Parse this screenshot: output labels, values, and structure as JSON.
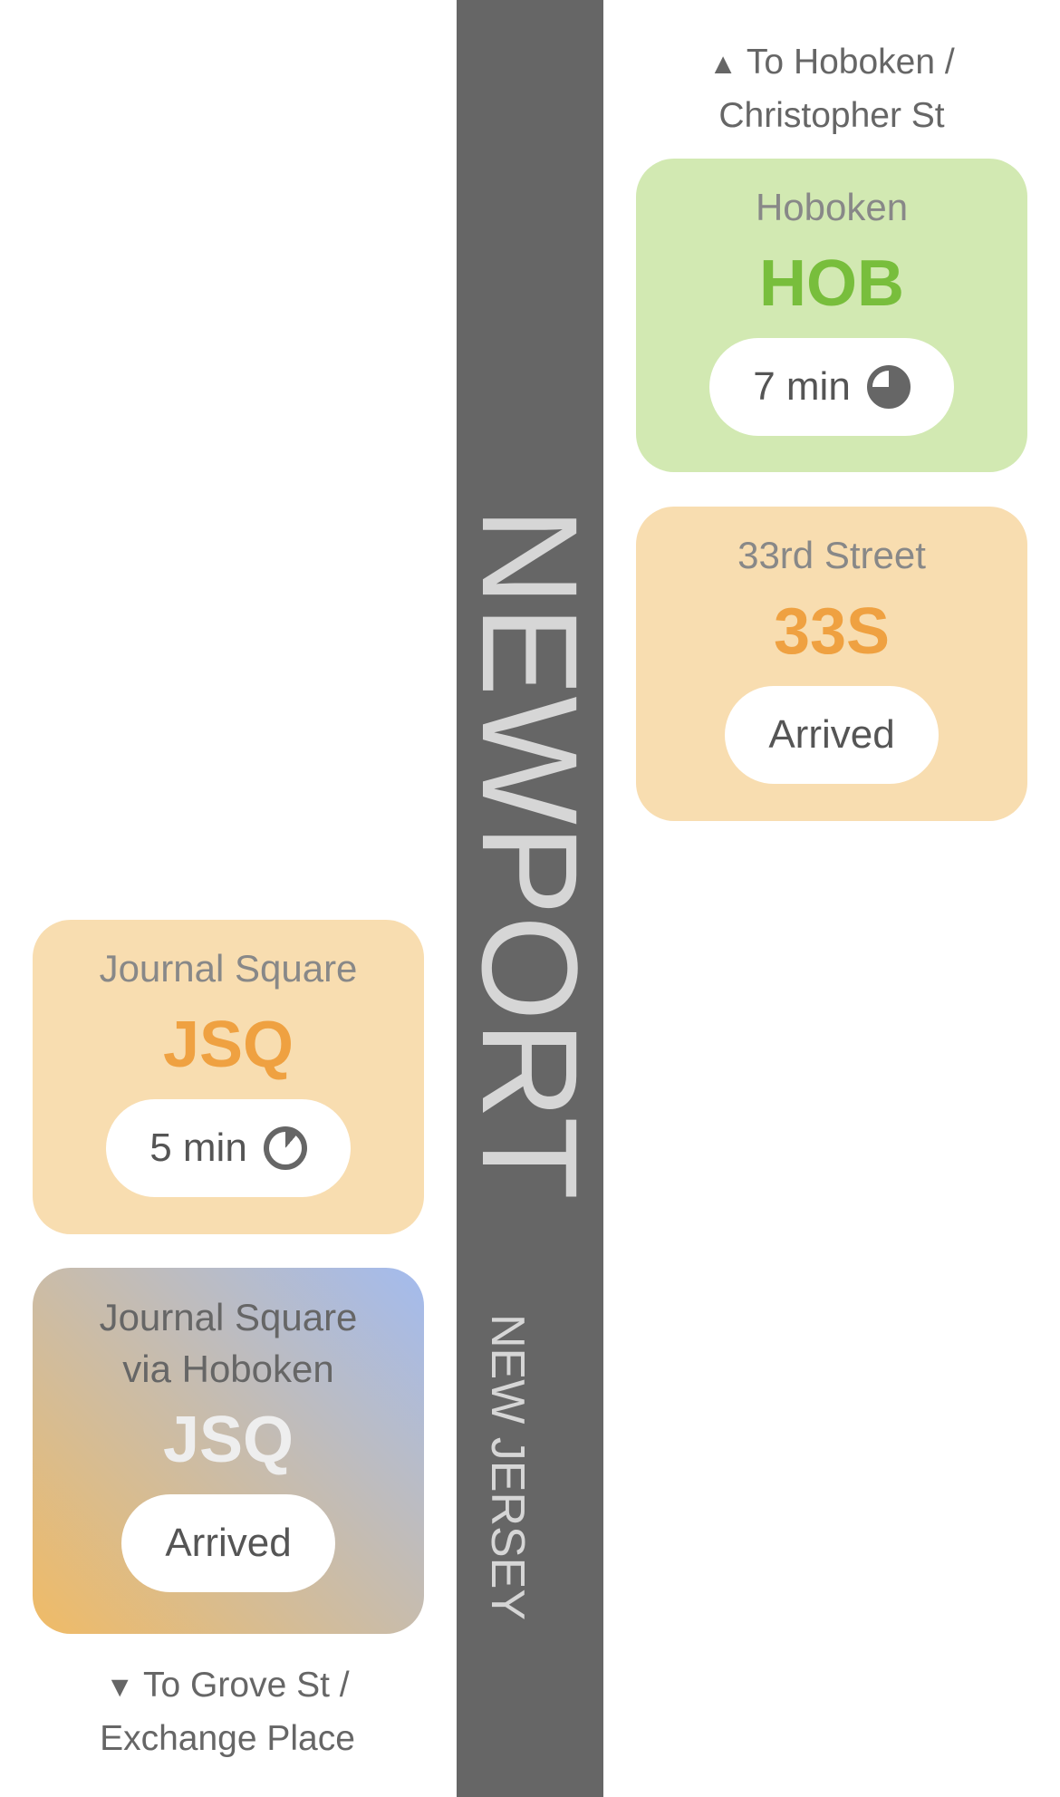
{
  "station": {
    "name": "NEWPORT",
    "state": "NEW JERSEY"
  },
  "directions": {
    "north": {
      "arrow": "▲",
      "line1": "To Hoboken /",
      "line2": "Christopher St"
    },
    "south": {
      "arrow": "▼",
      "line1": "To Grove St /",
      "line2": "Exchange Place"
    }
  },
  "trains": {
    "hob": {
      "destination": "Hoboken",
      "code": "HOB",
      "status": "7 min",
      "icon": "clock-icon"
    },
    "s33": {
      "destination": "33rd Street",
      "code": "33S",
      "status": "Arrived"
    },
    "jsq": {
      "destination": "Journal Square",
      "code": "JSQ",
      "status": "5 min",
      "icon": "clock-icon"
    },
    "jsqh": {
      "destination_line1": "Journal Square",
      "destination_line2": "via Hoboken",
      "code": "JSQ",
      "status": "Arrived"
    }
  },
  "colors": {
    "station_bar": "#666666",
    "hob_bg": "#d2e9b2",
    "hob_code": "#78be3c",
    "orange_bg": "#f8ddb0",
    "orange_code": "#efa141",
    "gradient_blue": "#a3bbee",
    "gradient_orange": "#f0bb66"
  }
}
